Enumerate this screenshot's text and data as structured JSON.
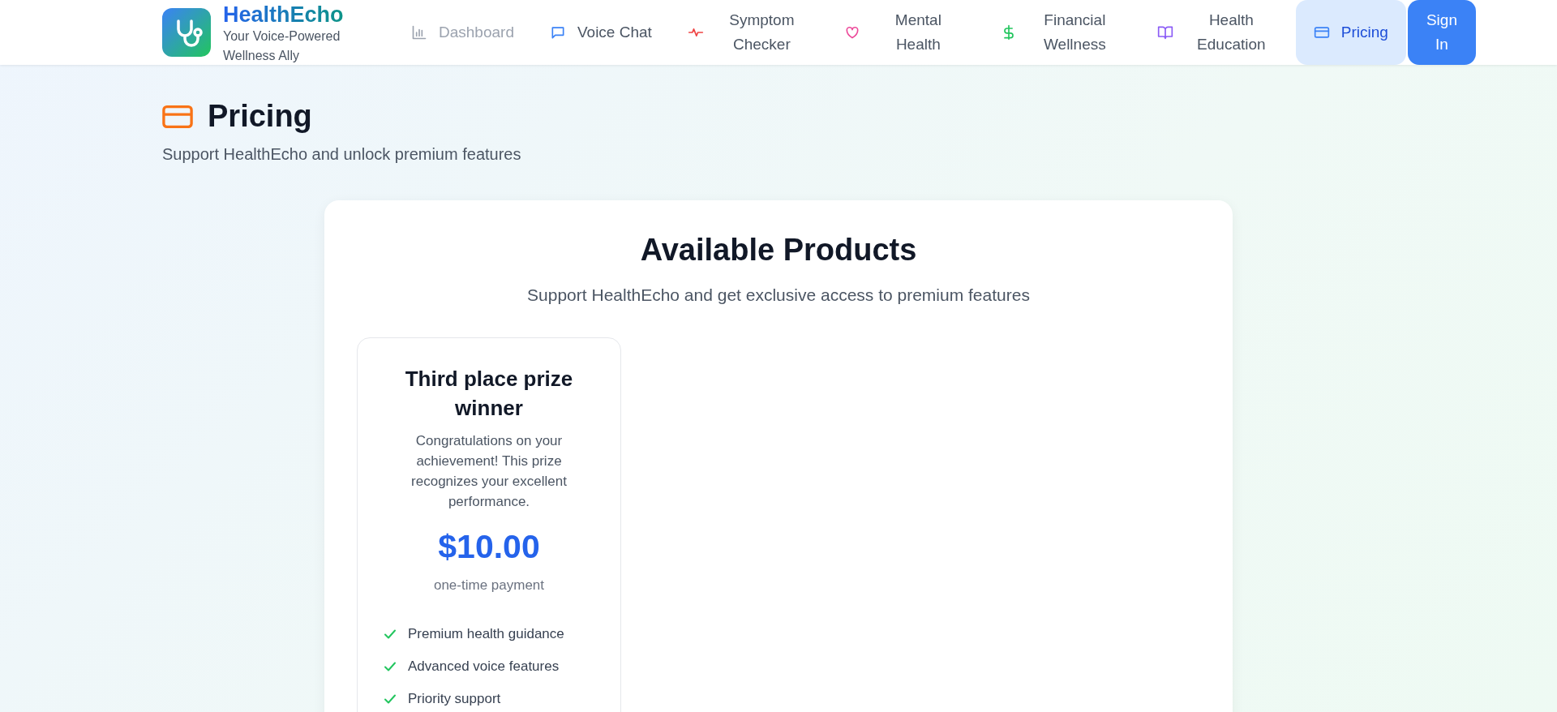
{
  "brand": {
    "name": "HealthEcho",
    "tagline": "Your Voice-Powered Wellness Ally"
  },
  "nav": [
    {
      "label": "Dashboard",
      "color": "#9ca3af",
      "selected": false,
      "disabled": true
    },
    {
      "label": "Voice Chat",
      "color": "#3b82f6",
      "selected": false,
      "disabled": false
    },
    {
      "label": "Symptom Checker",
      "color": "#ef4444",
      "selected": false,
      "disabled": false
    },
    {
      "label": "Mental Health",
      "color": "#ec4899",
      "selected": false,
      "disabled": false
    },
    {
      "label": "Financial Wellness",
      "color": "#22c55e",
      "selected": false,
      "disabled": false
    },
    {
      "label": "Health Education",
      "color": "#8b5cf6",
      "selected": false,
      "disabled": false
    },
    {
      "label": "Pricing",
      "color": "#3b82f6",
      "selected": true,
      "disabled": false
    }
  ],
  "sign_in": "Sign In",
  "page": {
    "title": "Pricing",
    "subtitle": "Support HealthEcho and unlock premium features"
  },
  "products_panel": {
    "title": "Available Products",
    "subtitle": "Support HealthEcho and get exclusive access to premium features",
    "products": [
      {
        "name": "Third place prize winner",
        "description": "Congratulations on your achievement! This prize recognizes your excellent performance.",
        "price": "$10.00",
        "billing": "one-time payment",
        "features": [
          "Premium health guidance",
          "Advanced voice features",
          "Priority support"
        ]
      }
    ]
  }
}
